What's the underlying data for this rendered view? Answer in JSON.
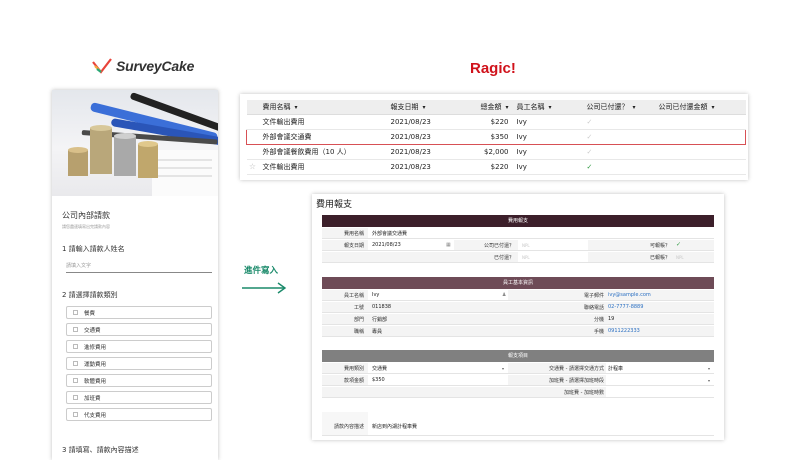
{
  "surveycake": {
    "logo_text": "SurveyCake",
    "form_title": "公司內部請款",
    "form_subtitle": "請您盡速填寫出完請款內容",
    "q1_label": "1 請輸入請款人姓名",
    "q1_placeholder": "請填入文字",
    "q2_label": "2 請選擇請款類別",
    "options": [
      "餐費",
      "交通費",
      "進修費用",
      "運動費用",
      "軟體費用",
      "加班費",
      "代支費用"
    ],
    "q3_label": "3 請填寫、請款內容描述"
  },
  "ragic": {
    "title": "Ragic!",
    "list": {
      "headers": [
        "費用名稱",
        "報支日期",
        "總金額",
        "員工名稱",
        "公司已付還？",
        "公司已付還金額"
      ],
      "rows": [
        {
          "name": "文件輸出費用",
          "date": "2021/08/23",
          "amount": "$220",
          "employee": "Ivy",
          "paid": "light",
          "highlight": false,
          "star": false
        },
        {
          "name": "外部會議交通費",
          "date": "2021/08/23",
          "amount": "$350",
          "employee": "Ivy",
          "paid": "light",
          "highlight": true,
          "star": false
        },
        {
          "name": "外部會議餐飲費用（10 人）",
          "date": "2021/08/23",
          "amount": "$2,000",
          "employee": "Ivy",
          "paid": "light",
          "highlight": false,
          "star": false
        },
        {
          "name": "文件輸出費用",
          "date": "2021/08/23",
          "amount": "$220",
          "employee": "Ivy",
          "paid": "green",
          "highlight": false,
          "star": true
        }
      ],
      "check_glyph": "✓",
      "star_glyph": "☆"
    },
    "form": {
      "title": "費用報支",
      "section1": "費用報支",
      "fee_name_label": "費用名稱",
      "fee_name_value": "外部會議交通費",
      "date_label": "報支日期",
      "date_value": "2021/08/23",
      "company_paid_label": "公司已付還？",
      "paid_label": "已付還？",
      "placeholder": "NPL",
      "can_apply_label": "可報帳？",
      "applied_label": "已報帳？",
      "section2": "員工基本資訊",
      "emp_name_label": "員工名稱",
      "emp_name_value": "Ivy",
      "email_label": "電子郵件",
      "email_value": "ivy@sample.com",
      "empno_label": "工號",
      "empno_value": "011838",
      "phone_label": "聯絡電話",
      "phone_value": "02-7777-8889",
      "dept_label": "部門",
      "dept_value": "行銷部",
      "ext_label": "分機",
      "ext_value": "19",
      "title_label": "職稱",
      "title_value": "專員",
      "mobile_label": "手機",
      "mobile_value": "0911222333",
      "section3": "報支項目",
      "category_label": "費用類別",
      "category_value": "交通費",
      "transport_label": "交通費 - 請選擇交通方式",
      "transport_value": "計程車",
      "amount_label": "款項金額",
      "amount_value": "$350",
      "overtime_label": "加班費 - 請選擇加班時段",
      "overtime_hours_label": "加班費 - 加班時數",
      "desc_label": "請款內容描述",
      "desc_value": "新店到內湖計程車費"
    }
  },
  "arrow_label": "進件寫入",
  "colors": {
    "ragic_red": "#d0121b",
    "arrow_green": "#1a8a6a",
    "section_dark": "#3c1f2a",
    "section_mauve": "#6e4b57",
    "section_gray": "#808080",
    "link_blue": "#2a6fc2",
    "check_green": "#2f9a41"
  }
}
